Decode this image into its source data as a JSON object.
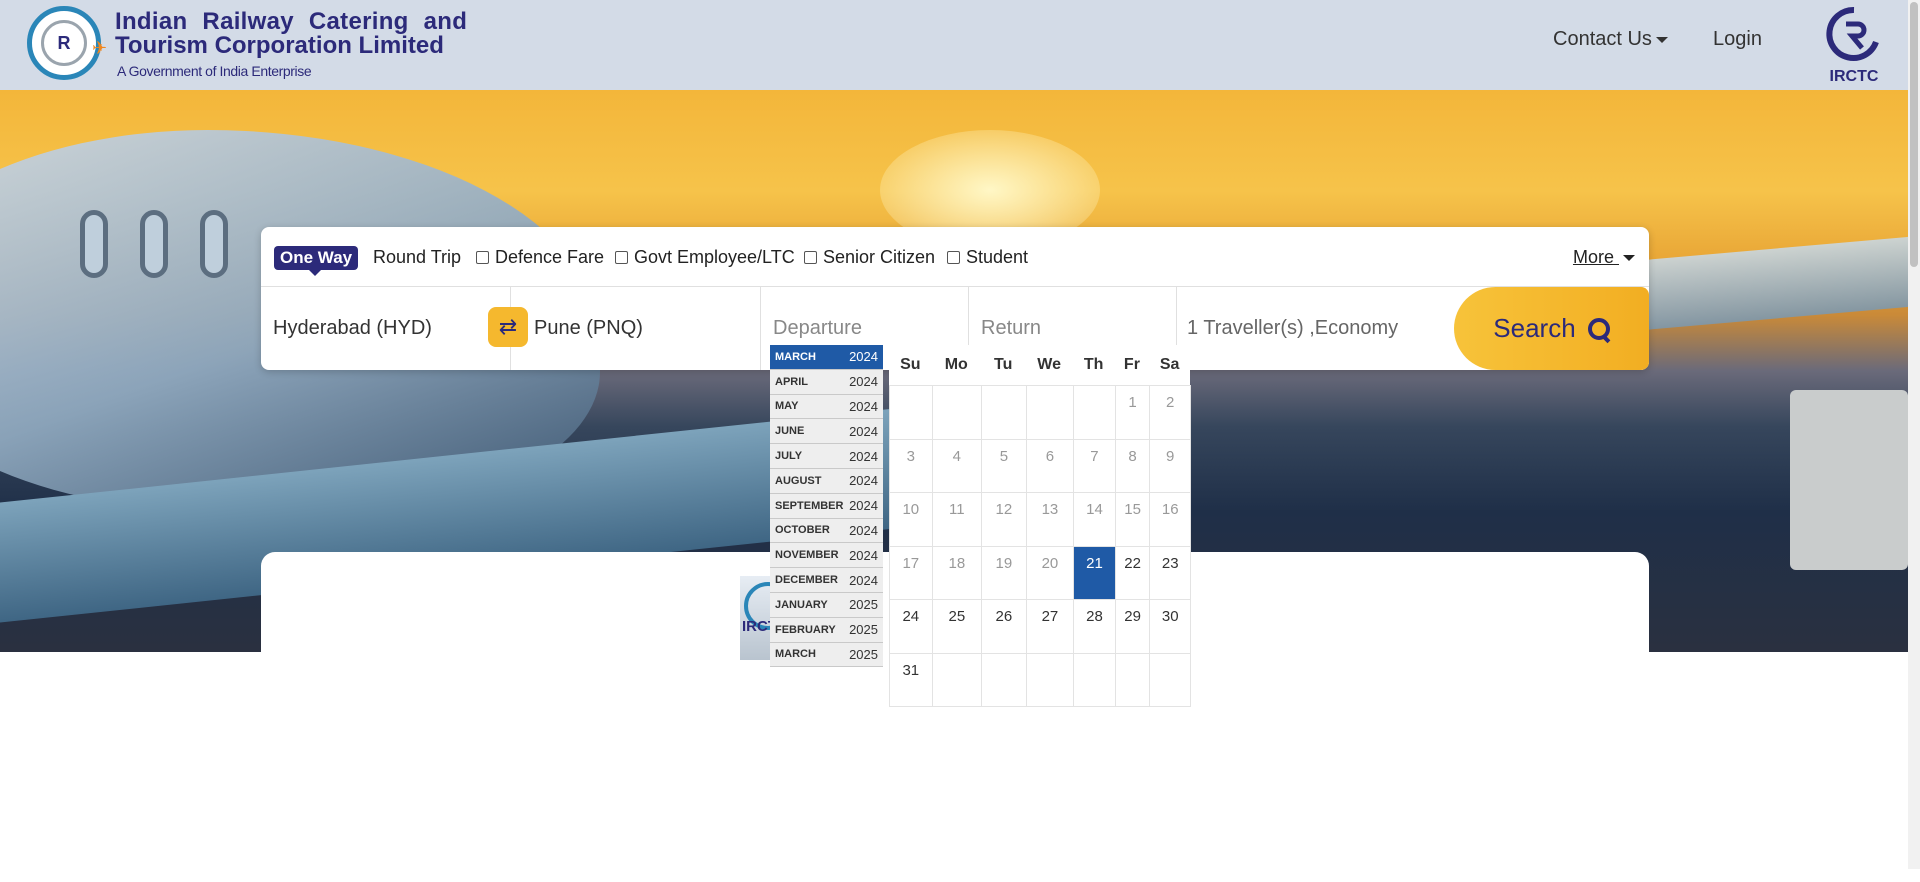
{
  "header": {
    "brand_line1": "Indian Railway Catering and",
    "brand_line2": "Tourism Corporation Limited",
    "brand_line3": "A Government of India Enterprise",
    "logo_glyph": "R",
    "nav_contact": "Contact Us",
    "nav_login": "Login",
    "right_logo_label": "IRCTC"
  },
  "search": {
    "trip_types": {
      "one_way": "One Way",
      "round_trip": "Round Trip"
    },
    "fare_options": [
      "Defence Fare",
      "Govt Employee/LTC",
      "Senior Citizen",
      "Student"
    ],
    "more_label": "More",
    "from": "Hyderabad (HYD)",
    "swap_icon": "⇄",
    "to": "Pune (PNQ)",
    "departure_placeholder": "Departure",
    "return_placeholder": "Return",
    "travellers": "1 Traveller(s) ,Economy",
    "search_button": "Search"
  },
  "small_logo_text": "IRCT",
  "months": [
    {
      "name": "MARCH",
      "year": "2024",
      "active": true
    },
    {
      "name": "APRIL",
      "year": "2024"
    },
    {
      "name": "MAY",
      "year": "2024"
    },
    {
      "name": "JUNE",
      "year": "2024"
    },
    {
      "name": "JULY",
      "year": "2024"
    },
    {
      "name": "AUGUST",
      "year": "2024"
    },
    {
      "name": "SEPTEMBER",
      "year": "2024"
    },
    {
      "name": "OCTOBER",
      "year": "2024"
    },
    {
      "name": "NOVEMBER",
      "year": "2024"
    },
    {
      "name": "DECEMBER",
      "year": "2024"
    },
    {
      "name": "JANUARY",
      "year": "2025"
    },
    {
      "name": "FEBRUARY",
      "year": "2025"
    },
    {
      "name": "MARCH",
      "year": "2025"
    }
  ],
  "calendar": {
    "weekdays": [
      "Su",
      "Mo",
      "Tu",
      "We",
      "Th",
      "Fr",
      "Sa"
    ],
    "weeks": [
      [
        "",
        "",
        "",
        "",
        "",
        "1",
        "2"
      ],
      [
        "3",
        "4",
        "5",
        "6",
        "7",
        "8",
        "9"
      ],
      [
        "10",
        "11",
        "12",
        "13",
        "14",
        "15",
        "16"
      ],
      [
        "17",
        "18",
        "19",
        "20",
        "21",
        "22",
        "23"
      ],
      [
        "24",
        "25",
        "26",
        "27",
        "28",
        "29",
        "30"
      ],
      [
        "31",
        "",
        "",
        "",
        "",
        "",
        ""
      ]
    ],
    "today": "21",
    "past_before": 21
  },
  "colors": {
    "brand": "#2c2a7a",
    "accent": "#f5b82e",
    "selected": "#1f5aa6",
    "header_bg": "#d3dbe7"
  }
}
